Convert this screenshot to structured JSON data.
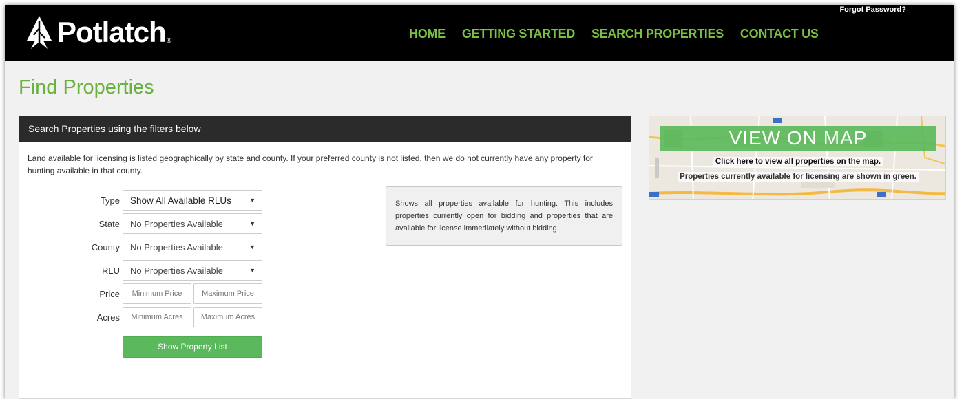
{
  "header": {
    "brand": "Potlatch",
    "brand_mark": "®",
    "forgot_password": "Forgot Password?",
    "nav": [
      {
        "label": "HOME"
      },
      {
        "label": "GETTING STARTED"
      },
      {
        "label": "SEARCH PROPERTIES"
      },
      {
        "label": "CONTACT US"
      }
    ]
  },
  "page": {
    "title": "Find Properties"
  },
  "search_panel": {
    "heading": "Search Properties using the filters below",
    "intro": "Land available for licensing is listed geographically by state and county. If your preferred county is not listed, then we do not currently have any property for hunting available in that county.",
    "type": {
      "label": "Type",
      "value": "Show All Available RLUs"
    },
    "state": {
      "label": "State",
      "value": "No Properties Available"
    },
    "county": {
      "label": "County",
      "value": "No Properties Available"
    },
    "rlu": {
      "label": "RLU",
      "value": "No Properties Available"
    },
    "price": {
      "label": "Price",
      "min_placeholder": "Minimum Price",
      "max_placeholder": "Maximum Price"
    },
    "acres": {
      "label": "Acres",
      "min_placeholder": "Minimum Acres",
      "max_placeholder": "Maximum Acres"
    },
    "submit_label": "Show Property List",
    "info_text": "Shows all properties available for hunting. This includes properties currently open for bidding and properties that are available for license immediately without bidding."
  },
  "map_card": {
    "button_label": "VIEW ON MAP",
    "caption": "Click here to view all properties on the map.",
    "subcaption": "Properties currently available for licensing are shown in green."
  },
  "colors": {
    "accent_green": "#7ac143",
    "title_green": "#6ab23e",
    "button_green": "#5cb85c",
    "header_bg": "#000000",
    "panel_head_bg": "#2b2b2b"
  }
}
